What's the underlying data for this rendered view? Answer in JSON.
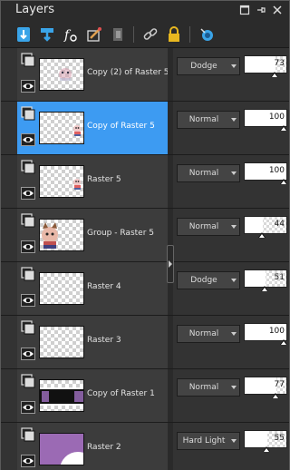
{
  "panel": {
    "title": "Layers",
    "controls": [
      "restore-icon",
      "pin-icon",
      "close-icon"
    ]
  },
  "toolbar": {
    "tools": [
      {
        "name": "new-raster-layer-icon",
        "color": "#3aa4e8"
      },
      {
        "name": "new-vector-layer-icon",
        "color": "#3aa4e8"
      },
      {
        "name": "new-adjustment-layer-icon",
        "color": "#ffffff"
      },
      {
        "name": "layer-styles-icon",
        "color": "#e0a050"
      },
      {
        "name": "new-mask-layer-icon",
        "color": "#777777"
      },
      {
        "name": "link-icon",
        "color": "#bbbbbb"
      },
      {
        "name": "lock-icon",
        "color": "#e8b820"
      },
      {
        "name": "visibility-toggle-icon",
        "color": "#3aa4e8"
      }
    ]
  },
  "layers": [
    {
      "name": "Copy (2) of Raster 5",
      "blend": "Dodge",
      "opacity": 73,
      "selected": false,
      "thumb": "cat-faded"
    },
    {
      "name": "Copy of Raster 5",
      "blend": "Normal",
      "opacity": 100,
      "selected": true,
      "thumb": "cat-small"
    },
    {
      "name": "Raster 5",
      "blend": "Normal",
      "opacity": 100,
      "selected": false,
      "thumb": "cat-small"
    },
    {
      "name": "Group - Raster 5",
      "blend": "Normal",
      "opacity": 44,
      "selected": false,
      "thumb": "cat-large"
    },
    {
      "name": "Raster 4",
      "blend": "Dodge",
      "opacity": 51,
      "selected": false,
      "thumb": "empty"
    },
    {
      "name": "Raster 3",
      "blend": "Normal",
      "opacity": 100,
      "selected": false,
      "thumb": "empty"
    },
    {
      "name": "Copy of Raster 1",
      "blend": "Normal",
      "opacity": 77,
      "selected": false,
      "thumb": "dark-strip"
    },
    {
      "name": "Raster 2",
      "blend": "Hard Light",
      "opacity": 55,
      "selected": false,
      "thumb": "purple"
    }
  ],
  "colors": {
    "selection": "#3d9bf2",
    "purple_layer": "#9b6ab4"
  }
}
